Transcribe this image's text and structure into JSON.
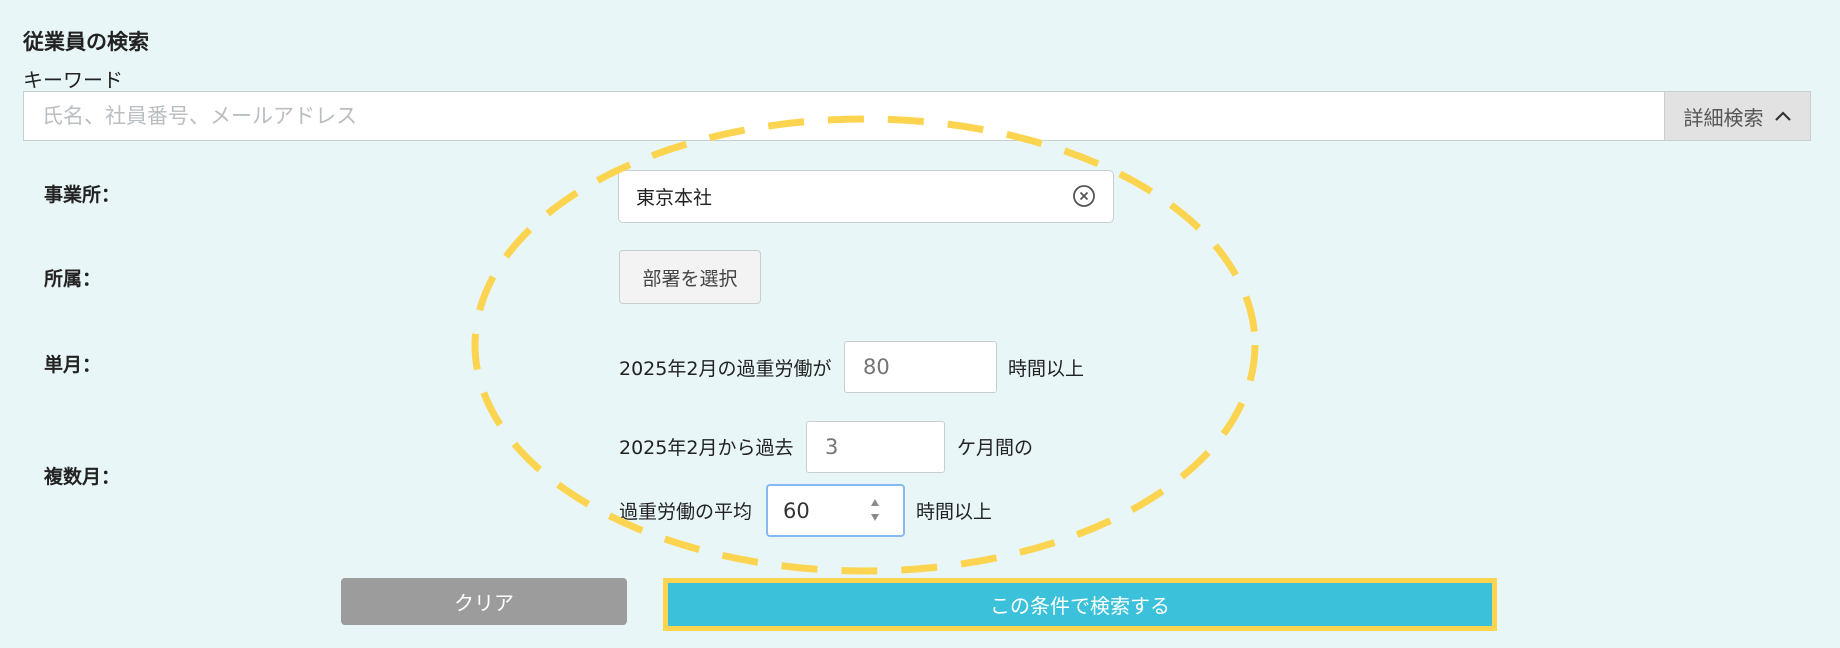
{
  "page": {
    "title": "従業員の検索",
    "keyword_label": "キーワード",
    "keyword_placeholder": "氏名、社員番号、メールアドレス",
    "keyword_value": "",
    "detail_search_label": "詳細検索"
  },
  "filters": {
    "office": {
      "label": "事業所：",
      "value": "東京本社"
    },
    "department": {
      "label": "所属：",
      "button_label": "部署を選択"
    },
    "single_month": {
      "label": "単月：",
      "prefix": "2025年2月の過重労働が",
      "hours_placeholder": "80",
      "suffix": "時間以上"
    },
    "multi_month": {
      "label": "複数月：",
      "prefix": "2025年2月から過去",
      "months_placeholder": "3",
      "months_suffix": "ケ月間の",
      "avg_prefix": "過重労働の平均",
      "avg_value": "60",
      "avg_suffix": "時間以上"
    }
  },
  "actions": {
    "clear_label": "クリア",
    "search_label": "この条件で検索する"
  },
  "colors": {
    "background": "#e9f6f8",
    "search_button": "#3cc1da",
    "clear_button": "#9b9c9b",
    "highlight": "#fcd450"
  },
  "icons": {
    "detail_toggle": "chevron-up-icon",
    "office_clear": "close-circle-icon",
    "number_spinner": "spinner-arrows-icon"
  }
}
